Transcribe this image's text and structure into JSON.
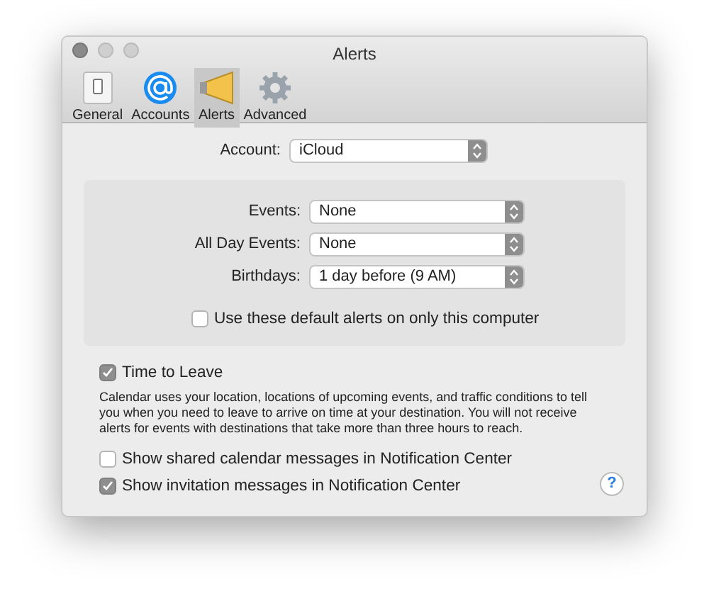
{
  "window": {
    "title": "Alerts"
  },
  "tabs": [
    {
      "label": "General",
      "kind": "general",
      "selected": false
    },
    {
      "label": "Accounts",
      "kind": "accounts",
      "selected": false
    },
    {
      "label": "Alerts",
      "kind": "alerts",
      "selected": true
    },
    {
      "label": "Advanced",
      "kind": "advanced",
      "selected": false
    }
  ],
  "account": {
    "label": "Account:",
    "value": "iCloud"
  },
  "defaults": [
    {
      "label": "Events:",
      "value": "None"
    },
    {
      "label": "All Day Events:",
      "value": "None"
    },
    {
      "label": "Birthdays:",
      "value": "1 day before (9 AM)"
    }
  ],
  "local_only": {
    "label": "Use these default alerts on only this computer",
    "checked": false
  },
  "time_to_leave": {
    "label": "Time to Leave",
    "checked": true,
    "description": "Calendar uses your location, locations of upcoming events, and traffic conditions to tell you when you need to leave to arrive on time at your destination. You will not receive alerts for events with destinations that take more than three hours to reach."
  },
  "options": [
    {
      "label": "Show shared calendar messages in Notification Center",
      "checked": false
    },
    {
      "label": "Show invitation messages in Notification Center",
      "checked": true
    }
  ],
  "help": "?"
}
